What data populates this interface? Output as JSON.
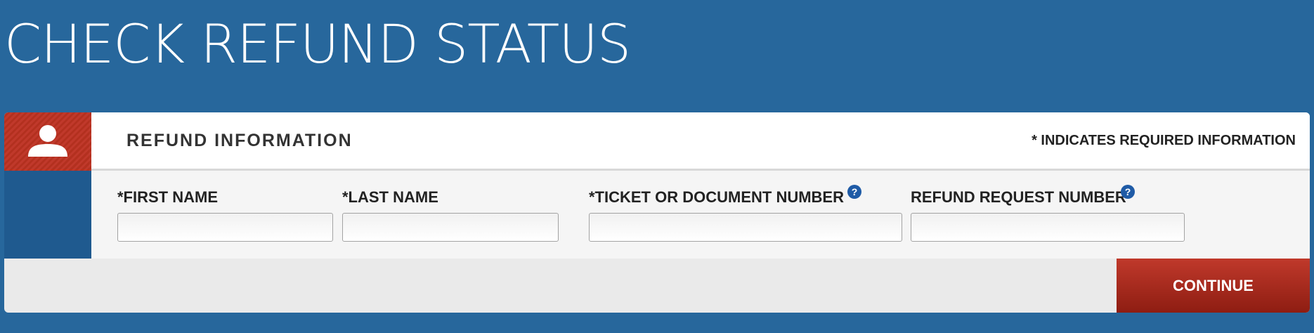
{
  "page": {
    "title": "CHECK REFUND STATUS"
  },
  "panel": {
    "icon": "user-icon",
    "title": "REFUND INFORMATION",
    "required_note": "* INDICATES REQUIRED INFORMATION"
  },
  "fields": {
    "first_name": {
      "label": "*FIRST NAME",
      "value": "",
      "placeholder": ""
    },
    "last_name": {
      "label": "*LAST NAME",
      "value": "",
      "placeholder": ""
    },
    "ticket_number": {
      "label": "*TICKET OR DOCUMENT NUMBER",
      "value": "",
      "placeholder": "",
      "help": "?"
    },
    "refund_request_number": {
      "label": "REFUND REQUEST NUMBER",
      "value": "",
      "placeholder": "",
      "help": "?"
    }
  },
  "actions": {
    "continue_label": "CONTINUE"
  },
  "colors": {
    "page_background": "#27679c",
    "accent_red": "#c0392b",
    "help_blue": "#1f5ba6"
  }
}
